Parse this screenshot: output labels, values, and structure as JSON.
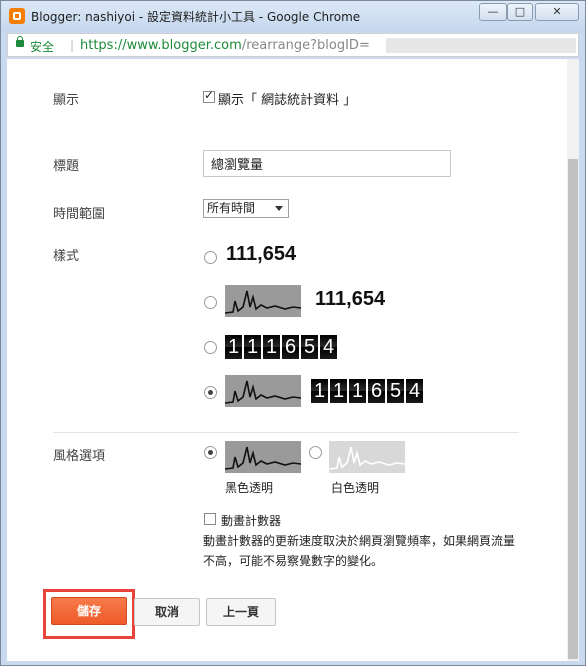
{
  "window": {
    "title": "Blogger: nashiyoi - 設定資料統計小工具 - Google Chrome",
    "minimize_glyph": "—",
    "maximize_glyph": "□",
    "close_glyph": "✕"
  },
  "address_bar": {
    "secure_label": "安全",
    "url_host": "https://www.blogger.com",
    "url_path": "/rearrange?blogID="
  },
  "form": {
    "display_label": "顯示",
    "display_checkbox_label": "顯示「 網誌統計資料 」",
    "display_checked": true,
    "title_label": "標題",
    "title_value": "總瀏覽量",
    "time_range_label": "時間範圍",
    "time_range_value": "所有時間",
    "style_label": "樣式",
    "style_options": [
      {
        "number": "111,654",
        "checked": false
      },
      {
        "number": "111,654",
        "checked": false
      },
      {
        "digits": [
          "1",
          "1",
          "1",
          "6",
          "5",
          "4"
        ],
        "checked": false
      },
      {
        "digits": [
          "1",
          "1",
          "1",
          "6",
          "5",
          "4"
        ],
        "checked": true
      }
    ],
    "color_label": "風格選項",
    "color_options": [
      {
        "label": "黑色透明",
        "checked": true
      },
      {
        "label": "白色透明",
        "checked": false
      }
    ],
    "animate_label": "動畫計數器",
    "animate_checked": false,
    "animate_note": "動畫計數器的更新速度取決於網頁瀏覽頻率，如果網頁流量不高，可能不易察覺數字的變化。"
  },
  "buttons": {
    "save": "儲存",
    "cancel": "取消",
    "previous": "上一頁"
  },
  "colors": {
    "accent": "#ee5b28",
    "highlight": "#e8443a",
    "secure_green": "#1b8a3a"
  }
}
